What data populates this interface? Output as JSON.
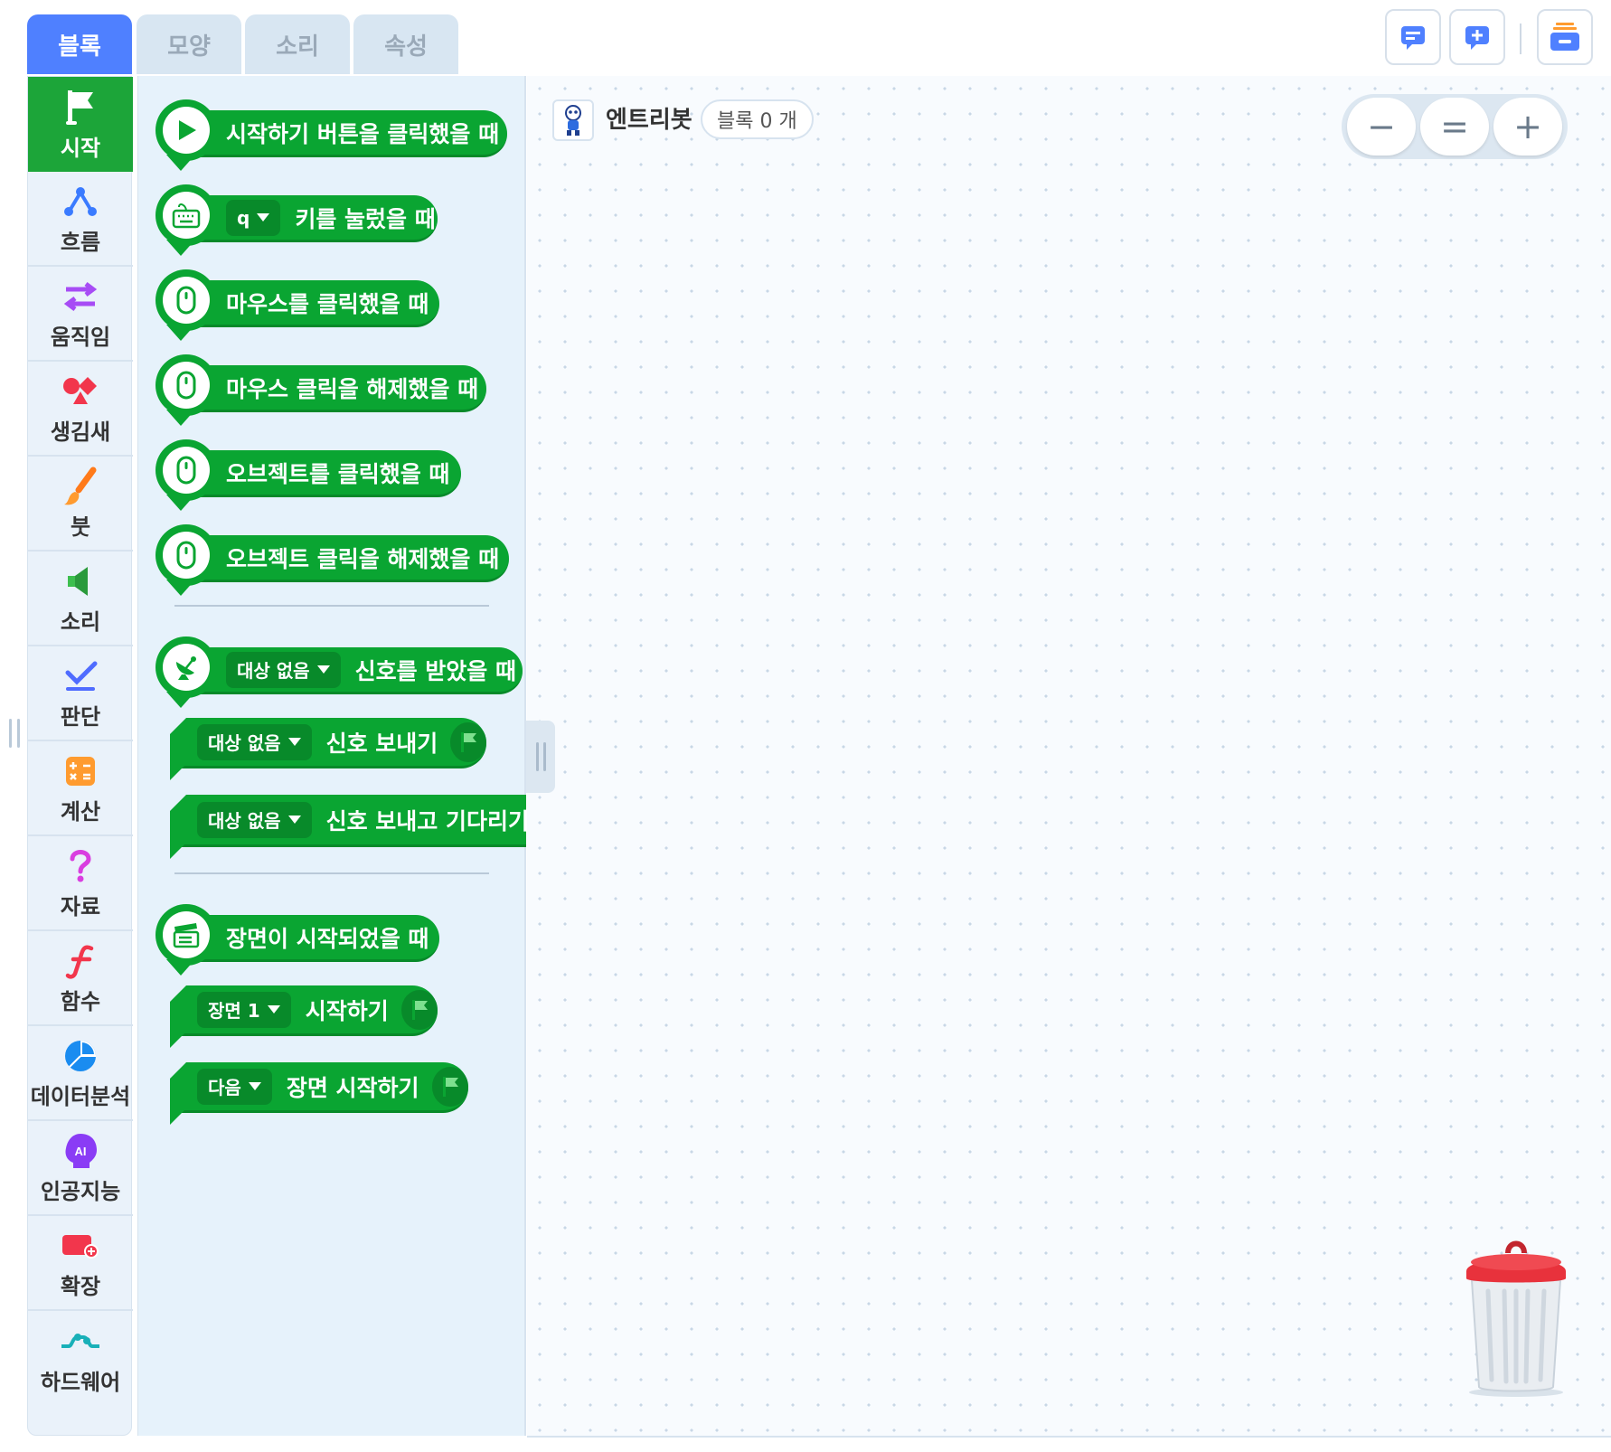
{
  "tabs": [
    "블록",
    "모양",
    "소리",
    "속성"
  ],
  "categories": [
    "시작",
    "흐름",
    "움직임",
    "생김새",
    "붓",
    "소리",
    "판단",
    "계산",
    "자료",
    "함수",
    "데이터분석",
    "인공지능",
    "확장",
    "하드웨어"
  ],
  "blocks": {
    "start_button": "시작하기 버튼을 클릭했을 때",
    "key_value": "q",
    "key_pressed": "키를 눌렀을 때",
    "mouse_click": "마우스를 클릭했을 때",
    "mouse_release": "마우스 클릭을 해제했을 때",
    "object_click": "오브젝트를 클릭했을 때",
    "object_release": "오브젝트 클릭을 해제했을 때",
    "signal_target": "대상 없음",
    "signal_received": "신호를 받았을 때",
    "signal_send": "신호 보내기",
    "signal_send_wait": "신호 보내고 기다리기",
    "scene_started": "장면이 시작되었을 때",
    "scene_value": "장면 1",
    "scene_start": "시작하기",
    "next_value": "다음",
    "next_scene_start": "장면 시작하기"
  },
  "workspace": {
    "object_name": "엔트리봇",
    "block_count": "블록 0 개",
    "zoom_out": "−",
    "zoom_reset": "=",
    "zoom_in": "+"
  },
  "colors": {
    "accent_blue": "#4f80ff",
    "block_green": "#0aa532",
    "block_dark_green": "#088a2a",
    "trash_red": "#e8323c"
  },
  "icons": {
    "toolbar": [
      "comment-icon",
      "add-comment-icon",
      "storage-box-icon"
    ],
    "categories": [
      "flag-icon",
      "flow-icon",
      "arrows-icon",
      "shapes-icon",
      "brush-icon",
      "speaker-icon",
      "check-icon",
      "calculator-icon",
      "question-icon",
      "function-icon",
      "pie-chart-icon",
      "ai-head-icon",
      "extension-icon",
      "hardware-icon"
    ]
  }
}
